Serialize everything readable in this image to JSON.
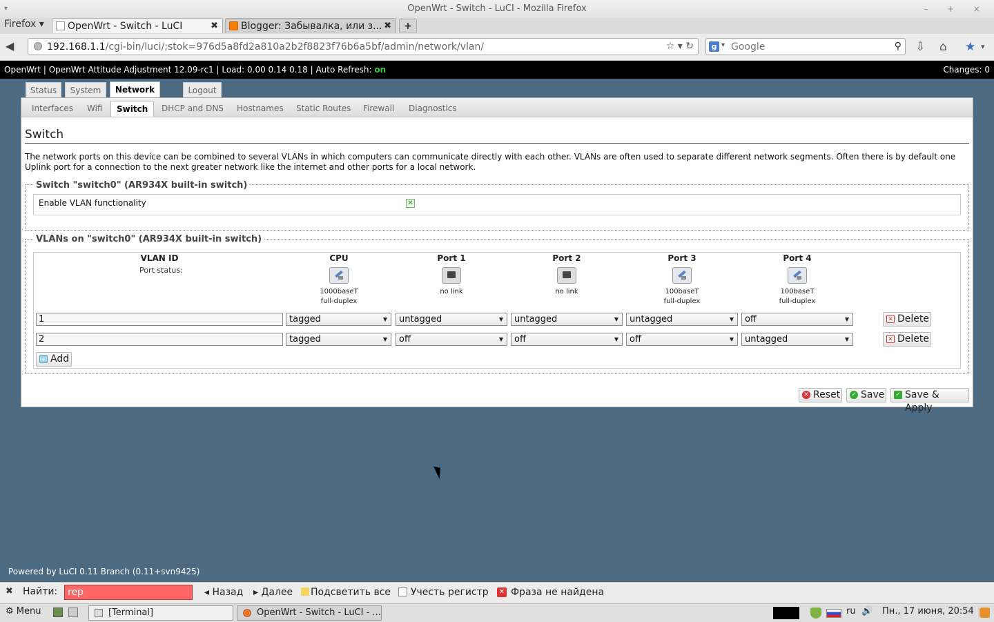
{
  "window": {
    "title": "OpenWrt - Switch - LuCI - Mozilla Firefox",
    "wm_left": "▾",
    "wm_buttons": "– + ×"
  },
  "browser": {
    "menu_label": "Firefox ▾",
    "tabs": [
      {
        "label": "OpenWrt - Switch - LuCI",
        "close": "✖"
      },
      {
        "label": "Blogger: Забывалка, или з...",
        "close": "✖"
      }
    ],
    "new_tab": "+",
    "back": "◀",
    "url_host": "192.168.1.1",
    "url_path": "/cgi-bin/luci/;stok=976d5a8fd2a810a2b2f8823f76b6a5bf/admin/network/vlan/",
    "url_tools": "☆ ▾ ↻",
    "search_engine": "g",
    "search_engine_caret": "▾",
    "search_placeholder": "Google",
    "search_button": "⚲",
    "download_icon": "⇩",
    "home_icon": "⌂",
    "addon_icon": "★",
    "addon_caret": "▾"
  },
  "luci_header": {
    "status_prefix": "OpenWrt | OpenWrt Attitude Adjustment 12.09-rc1 | Load: 0.00 0.14 0.18 | Auto Refresh: ",
    "auto_refresh": "on",
    "changes": "Changes: 0"
  },
  "main_tabs": [
    "Status",
    "System",
    "Network",
    "Logout"
  ],
  "sub_tabs": [
    "Interfaces",
    "Wifi",
    "Switch",
    "DHCP and DNS",
    "Hostnames",
    "Static Routes",
    "Firewall",
    "Diagnostics"
  ],
  "page": {
    "title": "Switch",
    "description": "The network ports on this device can be combined to several VLANs in which computers can communicate directly with each other. VLANs are often used to separate different network segments. Often there is by default one Uplink port for a connection to the next greater network like the internet and other ports for a local network."
  },
  "switch_section": {
    "legend": "Switch \"switch0\" (AR934X built-in switch)",
    "enable_vlan_label": "Enable VLAN functionality",
    "enable_vlan_checked": true,
    "check_glyph": "✕"
  },
  "vlan_section": {
    "legend": "VLANs on \"switch0\" (AR934X built-in switch)",
    "vlan_id_header": "VLAN ID",
    "port_status_label": "Port status:",
    "ports": [
      {
        "name": "CPU",
        "status_line1": "1000baseT",
        "status_line2": "full-duplex",
        "link": true
      },
      {
        "name": "Port 1",
        "status_line1": "no link",
        "status_line2": "",
        "link": false
      },
      {
        "name": "Port 2",
        "status_line1": "no link",
        "status_line2": "",
        "link": false
      },
      {
        "name": "Port 3",
        "status_line1": "100baseT",
        "status_line2": "full-duplex",
        "link": true
      },
      {
        "name": "Port 4",
        "status_line1": "100baseT",
        "status_line2": "full-duplex",
        "link": true
      }
    ],
    "rows": [
      {
        "vlan_id": "1",
        "values": [
          "tagged",
          "untagged",
          "untagged",
          "untagged",
          "off"
        ],
        "delete": "Delete"
      },
      {
        "vlan_id": "2",
        "values": [
          "tagged",
          "off",
          "off",
          "off",
          "untagged"
        ],
        "delete": "Delete"
      }
    ],
    "add_label": "Add"
  },
  "actions": {
    "reset": "Reset",
    "save": "Save",
    "save_apply": "Save & Apply"
  },
  "footer": "Powered by LuCI 0.11 Branch (0.11+svn9425)",
  "findbar": {
    "close": "✖",
    "label": "Найти:",
    "query": "rep",
    "prev": "◂ Назад",
    "next": "▸ Далее",
    "highlight": "Подсветить все",
    "match_case": "Учесть регистр",
    "status": "Фраза не найдена",
    "status_glyph": "✕"
  },
  "taskbar": {
    "menu": "⚙ Menu",
    "tasks": [
      "[Terminal]",
      "OpenWrt - Switch - LuCI - ..."
    ],
    "lang": "ru",
    "volume": "🔊",
    "clock": "Пн., 17 июня, 20:54"
  }
}
